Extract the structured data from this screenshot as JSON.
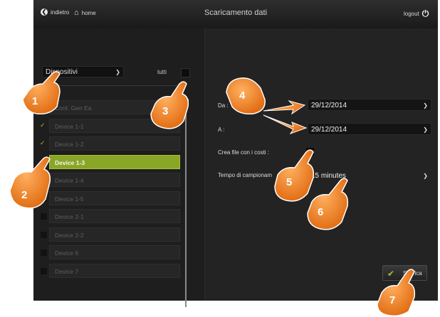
{
  "header": {
    "back_label": "indietro",
    "home_label": "home",
    "title": "Scaricamento dati",
    "logout_label": "logout"
  },
  "devices": {
    "dropdown_value": "Dispositivi",
    "select_all_label": "tutti",
    "items": [
      {
        "label": "Cont. Gen Ea",
        "checked": false,
        "selected": false
      },
      {
        "label": "Device 1-1",
        "checked": true,
        "selected": false
      },
      {
        "label": "Device 1-2",
        "checked": true,
        "selected": false
      },
      {
        "label": "Device 1-3",
        "checked": false,
        "selected": true
      },
      {
        "label": "Device 1-4",
        "checked": false,
        "selected": false
      },
      {
        "label": "Device 1-5",
        "checked": false,
        "selected": false
      },
      {
        "label": "Device 2-1",
        "checked": false,
        "selected": false
      },
      {
        "label": "Device 2-2",
        "checked": false,
        "selected": false
      },
      {
        "label": "Device 6",
        "checked": false,
        "selected": false
      },
      {
        "label": "Device 7",
        "checked": false,
        "selected": false
      }
    ]
  },
  "form": {
    "from_label": "Da :",
    "from_value": "29/12/2014",
    "to_label": "A :",
    "to_value": "29/12/2014",
    "costs_label": "Crea file con i costi :",
    "sampling_label": "Tempo di campionam",
    "sampling_value": "15 minutes",
    "download_label": "Scarica"
  },
  "annotations": [
    "1",
    "2",
    "3",
    "4",
    "5",
    "6",
    "7"
  ],
  "colors": {
    "accent_green": "#8aa626",
    "annotation_orange": "#f07a1e"
  }
}
